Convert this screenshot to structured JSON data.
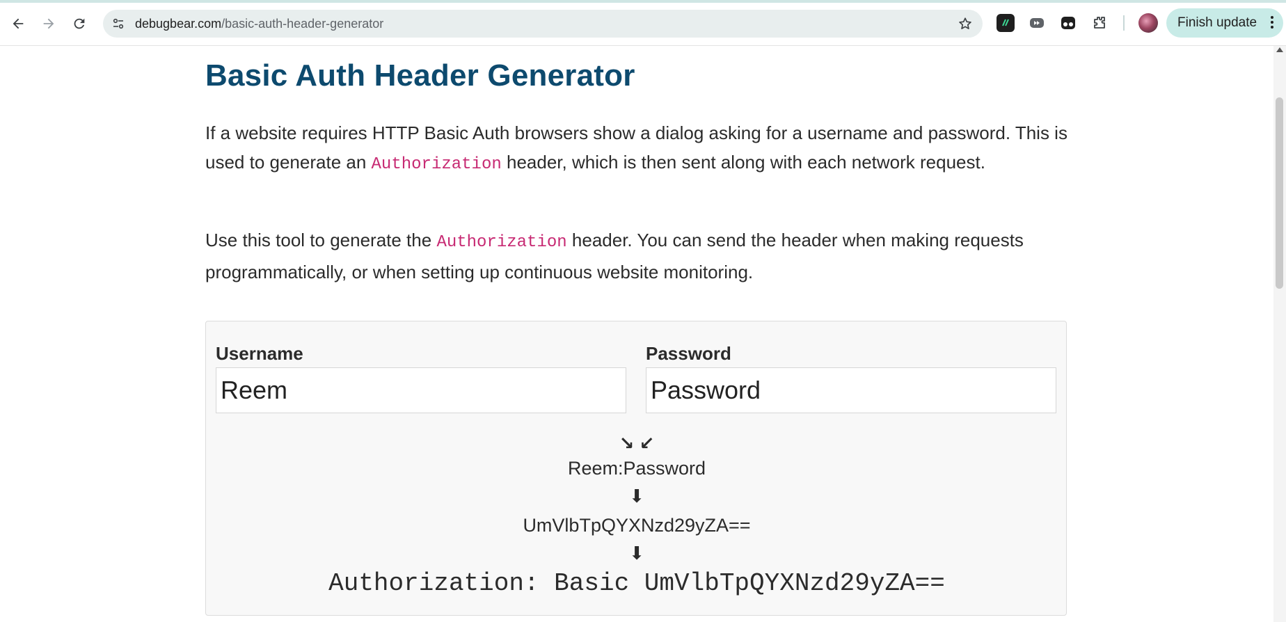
{
  "browser": {
    "url_domain": "debugbear.com",
    "url_path": "/basic-auth-header-generator",
    "finish_update_label": "Finish update",
    "icons": [
      "back-icon",
      "forward-icon",
      "reload-icon",
      "site-info-icon",
      "star-icon",
      "extension-icon",
      "puzzle-icon",
      "more-icon"
    ]
  },
  "page": {
    "title": "Basic Auth Header Generator",
    "intro": {
      "before": "If a website requires HTTP Basic Auth browsers show a dialog asking for a username and password. This is used to generate an ",
      "code": "Authorization",
      "after": " header, which is then sent along with each network request."
    },
    "usage": {
      "before": "Use this tool to generate the ",
      "code": "Authorization",
      "after": " header. You can send the header when making requests programmatically, or when setting up continuous website monitoring."
    }
  },
  "tool": {
    "username_label": "Username",
    "username_value": "Reem",
    "password_label": "Password",
    "password_placeholder": "Password",
    "merge_arrows": "↘ ↙",
    "combined": "Reem:Password",
    "down_arrow": "⬇",
    "encoded": "UmVlbTpQYXNzd29yZA==",
    "header_output": "Authorization: Basic UmVlbTpQYXNzd29yZA=="
  },
  "colors": {
    "title": "#0d4a6e",
    "code": "#c72a73",
    "update_button": "#c8ebe7"
  }
}
